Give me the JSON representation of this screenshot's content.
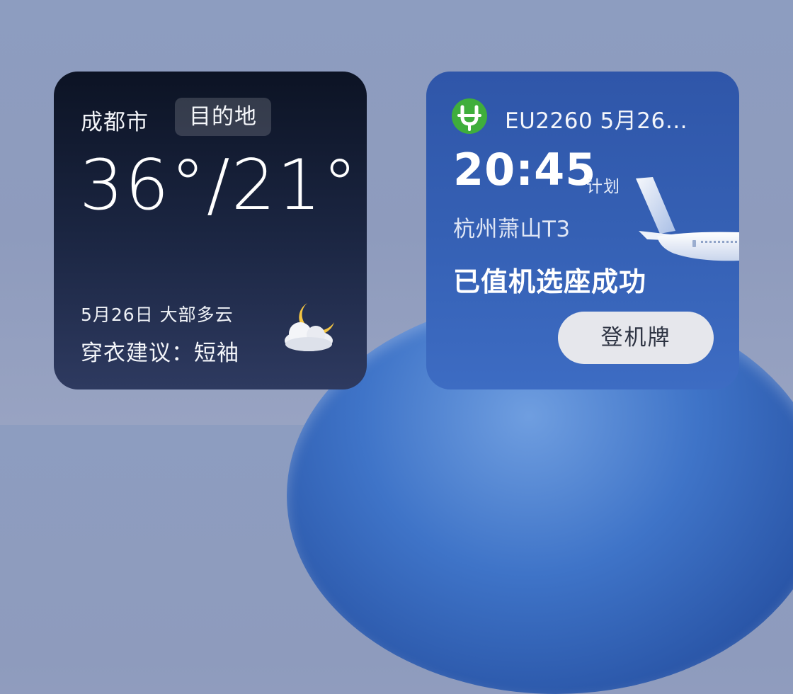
{
  "weather_widget": {
    "city": "成都市",
    "destination_badge": "目的地",
    "temperature": "36°/21°",
    "date_condition": "5月26日 大部多云",
    "clothing_advice": "穿衣建议：短袖",
    "icon": "partly-cloudy-night-icon"
  },
  "flight_widget": {
    "airline_logo": "airline-logo-icon",
    "header": "EU2260 5月26…",
    "time": "20:45",
    "time_tag": "计划",
    "airport": "杭州萧山T3",
    "status": "已值机选座成功",
    "boarding_pass_label": "登机牌",
    "plane_art": "airplane-icon"
  },
  "colors": {
    "weather_bg_top": "#0c1324",
    "weather_bg_bottom": "#2e3a60",
    "flight_bg": "#3560b4",
    "airline_green": "#3fae3c",
    "moon_yellow": "#f4c542",
    "button_bg": "#e6e7ec"
  }
}
